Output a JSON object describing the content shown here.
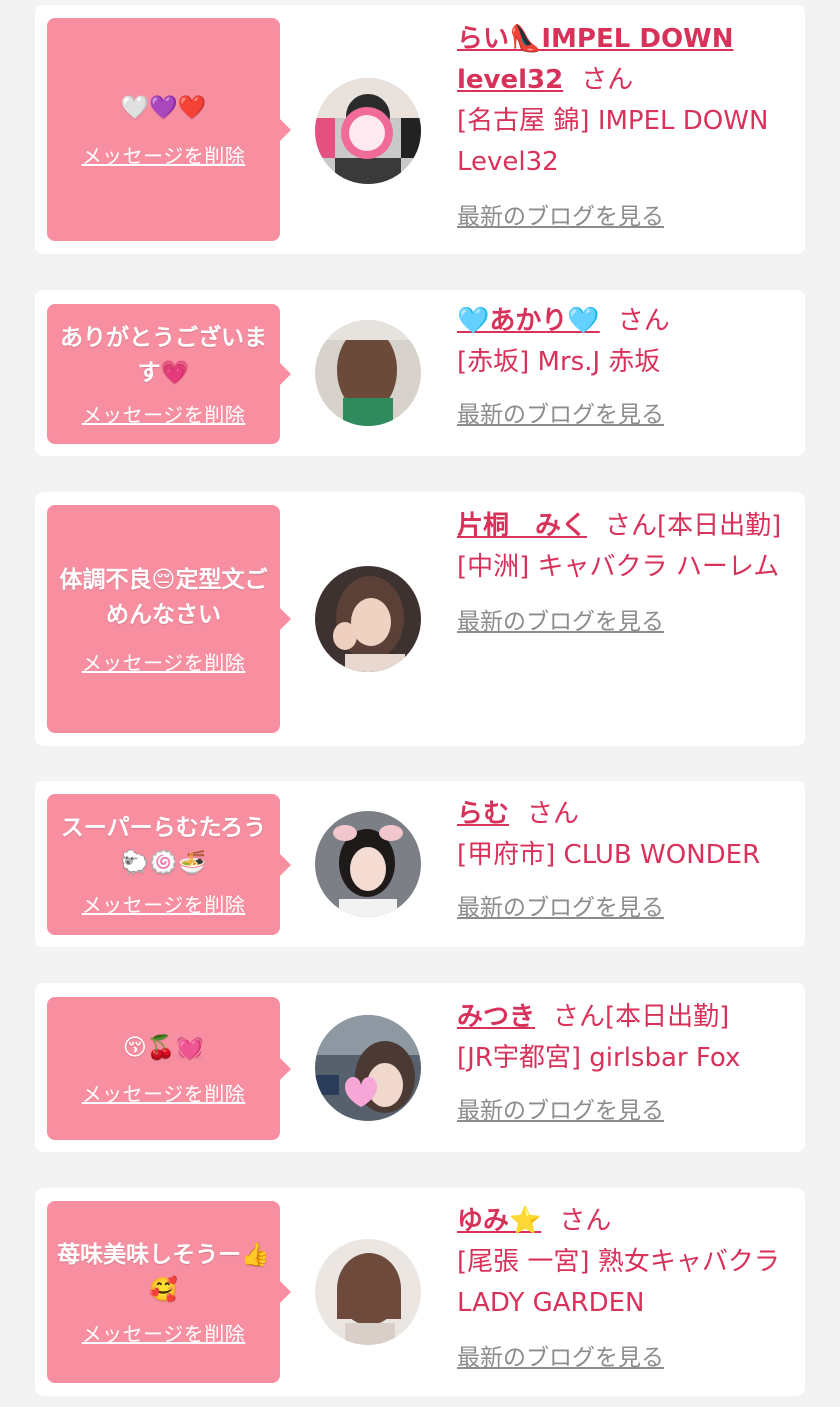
{
  "items": [
    {
      "message": "🤍💜❤️",
      "delete_label": "メッセージを削除",
      "name": "らい👠IMPEL DOWN level32",
      "honorific": "さん",
      "status": "",
      "shop": "[名古屋 錦] IMPEL DOWN Level32",
      "blog_label": "最新のブログを見る",
      "avatar_icon": "avatar-photo-icon"
    },
    {
      "message": "ありがとうございます💗",
      "delete_label": "メッセージを削除",
      "name": "🩵あかり🩵",
      "honorific": "さん",
      "status": "",
      "shop": "[赤坂] Mrs.J 赤坂",
      "blog_label": "最新のブログを見る",
      "avatar_icon": "avatar-photo-icon"
    },
    {
      "message": "体調不良😔定型文ごめんなさい",
      "delete_label": "メッセージを削除",
      "name": "片桐　みく",
      "honorific": "さん",
      "status": "[本日出勤]",
      "shop": "[中洲] キャバクラ ハーレム",
      "blog_label": "最新のブログを見る",
      "avatar_icon": "avatar-photo-icon"
    },
    {
      "message": "スーパーらむたろう🐑🍥🍜",
      "delete_label": "メッセージを削除",
      "name": "らむ",
      "honorific": "さん",
      "status": "",
      "shop": "[甲府市] CLUB WONDER",
      "blog_label": "最新のブログを見る",
      "avatar_icon": "avatar-photo-icon"
    },
    {
      "message": "😚🍒💓",
      "delete_label": "メッセージを削除",
      "name": "みつき",
      "honorific": "さん",
      "status": "[本日出勤]",
      "shop": "[JR宇都宮] girlsbar Fox",
      "blog_label": "最新のブログを見る",
      "avatar_icon": "avatar-photo-icon"
    },
    {
      "message": "苺味美味しそうー👍🥰",
      "delete_label": "メッセージを削除",
      "name": "ゆみ⭐️",
      "honorific": "さん",
      "status": "",
      "shop": "[尾張 一宮] 熟女キャバクラ LADY GARDEN",
      "blog_label": "最新のブログを見る",
      "avatar_icon": "avatar-photo-icon"
    }
  ],
  "colors": {
    "accent": "#d8325a",
    "bubble": "#f78fa1",
    "link_gray": "#8c8c8c",
    "background": "#f3f3f3"
  }
}
